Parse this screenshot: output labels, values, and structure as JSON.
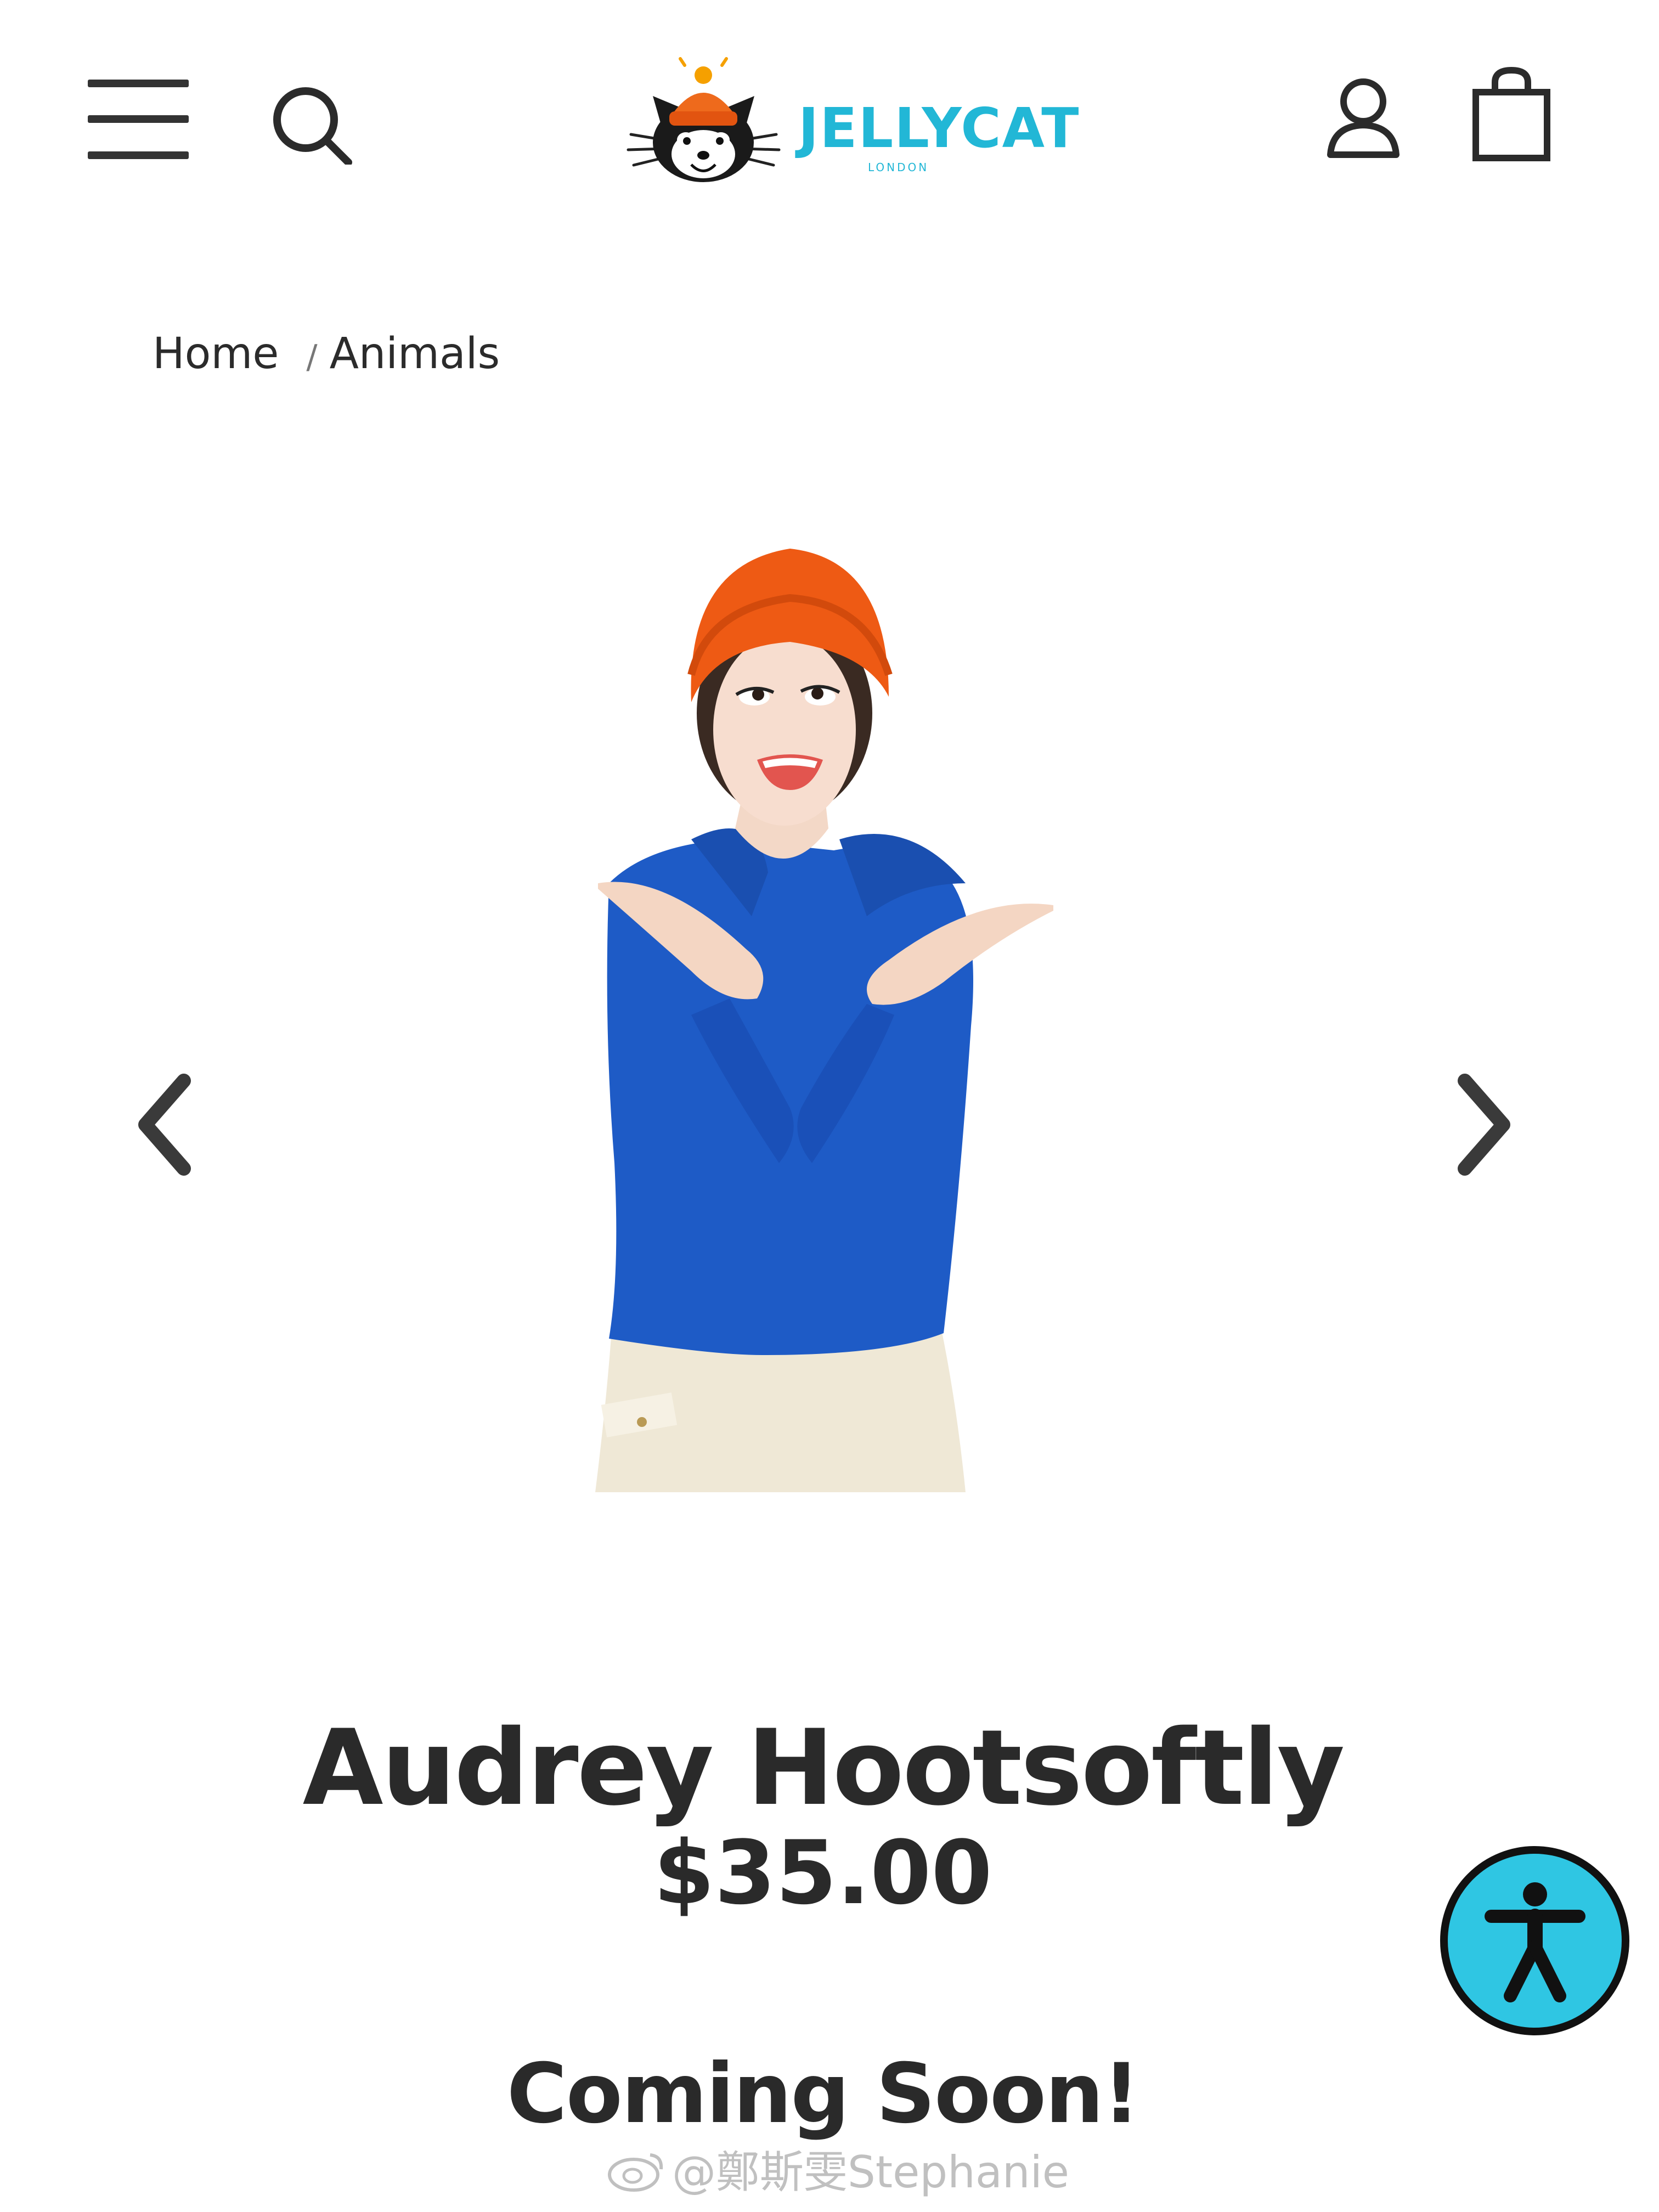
{
  "header": {
    "menu_icon": "hamburger-menu-icon",
    "search_icon": "search-icon",
    "logo": {
      "icon": "cat-face-icon",
      "text": "JELLYCAT",
      "subtext": "LONDON"
    },
    "account_icon": "user-account-icon",
    "bag_icon": "shopping-bag-icon"
  },
  "breadcrumb": {
    "home": "Home",
    "separator": "/",
    "current": "Animals"
  },
  "carousel": {
    "prev_icon": "chevron-left-icon",
    "next_icon": "chevron-right-icon"
  },
  "product": {
    "image_icon": "product-photo",
    "title": "Audrey Hootsoftly",
    "price": "$35.00",
    "availability": "Coming Soon!"
  },
  "accessibility": {
    "icon": "accessibility-person-icon"
  },
  "watermark": {
    "text": "@鄭斯雯Stephanie"
  },
  "colors": {
    "brand": "#22b7d6",
    "accessibility_bg": "#2fc6e3",
    "text": "#2a2a2a",
    "hat": "#ee5a14",
    "sweater": "#1e5bc6"
  }
}
